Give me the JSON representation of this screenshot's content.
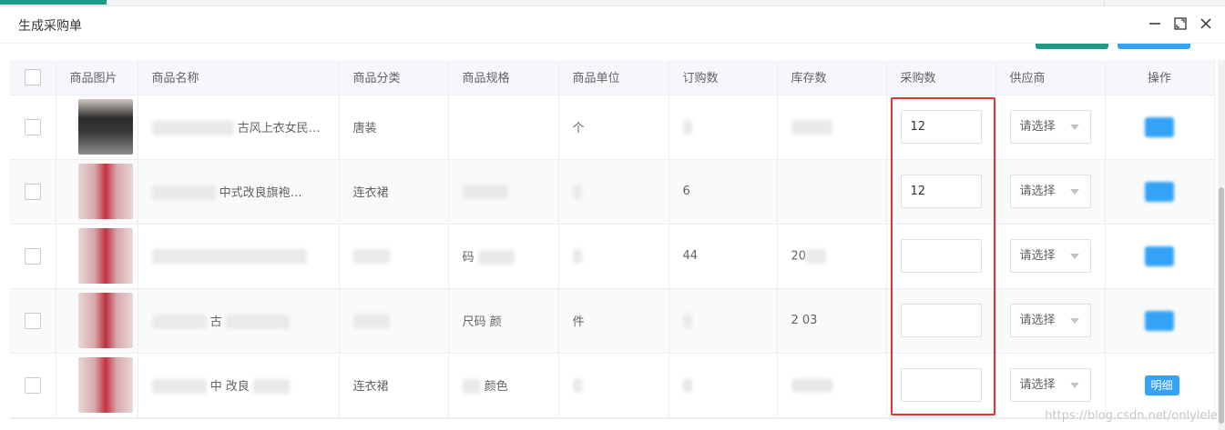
{
  "dialog": {
    "title": "生成采购单"
  },
  "window_icons": [
    "minimize-icon",
    "maximize-icon",
    "close-icon"
  ],
  "columns": [
    "商品图片",
    "商品名称",
    "商品分类",
    "商品规格",
    "商品单位",
    "订购数",
    "库存数",
    "采购数",
    "供应商",
    "操作"
  ],
  "rows": [
    {
      "name": "古风上衣女民…",
      "category": "唐装",
      "spec": "",
      "unit": "个",
      "ordered": "",
      "stock": "",
      "purchase_qty": "12",
      "supplier": "请选择",
      "action": ""
    },
    {
      "name": "中式改良旗袍…",
      "category": "连衣裙",
      "spec": "",
      "unit": "",
      "ordered": "6",
      "stock": "",
      "purchase_qty": "12",
      "supplier": "请选择",
      "action": ""
    },
    {
      "name": "",
      "category": "",
      "spec": "码",
      "unit": "",
      "ordered": "44",
      "stock": "20",
      "purchase_qty": "",
      "supplier": "请选择",
      "action": ""
    },
    {
      "name": "古",
      "category": "",
      "spec": "尺码  颜",
      "unit": "件",
      "ordered": "",
      "stock": "2 03",
      "purchase_qty": "",
      "supplier": "请选择",
      "action": ""
    },
    {
      "name": "中 改良",
      "category": "连衣裙",
      "spec": "颜色",
      "unit": "",
      "ordered": "",
      "stock": "",
      "purchase_qty": "",
      "supplier": "请选择",
      "action": "明细"
    }
  ],
  "colors": {
    "accent_green": "#1f9b85",
    "accent_blue": "#33a3f7",
    "highlight_red": "#e3332f"
  },
  "watermark": "https://blog.csdn.net/onlylele"
}
